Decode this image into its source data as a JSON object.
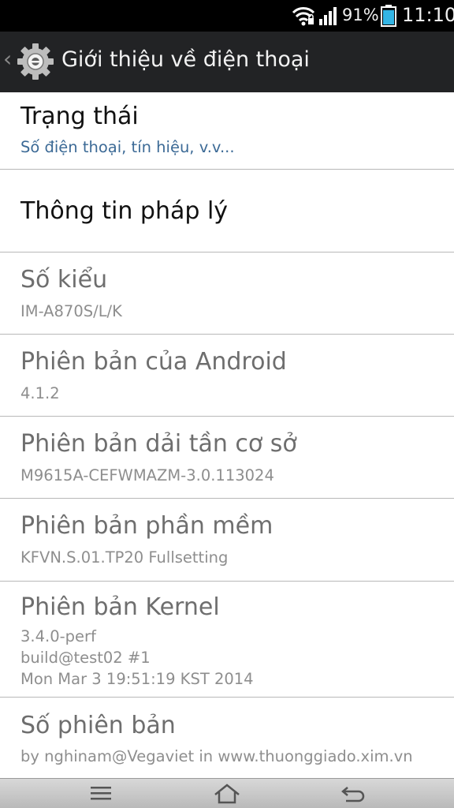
{
  "status_bar": {
    "battery_percent": "91%",
    "time": "11:10",
    "icons": [
      "wifi-icon",
      "signal-icon",
      "battery-icon"
    ],
    "battery_level": 0.91
  },
  "action_bar": {
    "back_icon": "chevron-left-icon",
    "app_icon": "settings-gear-icon",
    "title": "Giới thiệu về điện thoại"
  },
  "list": {
    "items": [
      {
        "title": "Trạng thái",
        "summary": "Số điện thoại, tín hiệu, v.v..."
      },
      {
        "title": "Thông tin pháp lý",
        "summary": ""
      },
      {
        "title": "Số kiểu",
        "summary": "IM-A870S/L/K"
      },
      {
        "title": "Phiên bản của Android",
        "summary": "4.1.2"
      },
      {
        "title": "Phiên bản dải tần cơ sở",
        "summary": "M9615A-CEFWMAZM-3.0.113024"
      },
      {
        "title": "Phiên bản phần mềm",
        "summary": "KFVN.S.01.TP20 Fullsetting"
      },
      {
        "title": "Phiên bản Kernel",
        "summary": "3.4.0-perf\nbuild@test02 #1\nMon Mar 3 19:51:19 KST 2014"
      },
      {
        "title": "Số phiên bản",
        "summary": "by nghinam@Vegaviet in www.thuonggiado.xim.vn"
      }
    ]
  },
  "nav_bar": {
    "icons": [
      "menu-icon",
      "home-icon",
      "back-icon"
    ]
  },
  "colors": {
    "status_bar_bg": "#000000",
    "action_bar_bg": "#222325",
    "list_bg": "#ffffff",
    "summary_accent": "#3c6a96",
    "divider": "#b8b8b8",
    "battery_fill": "#33b5e5"
  }
}
